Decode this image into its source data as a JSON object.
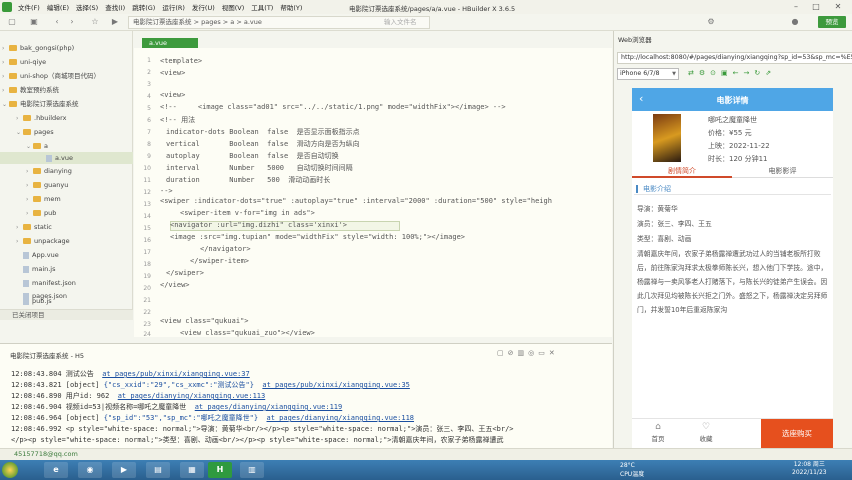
{
  "menu": {
    "items": [
      "文件(F)",
      "编辑(E)",
      "选择(S)",
      "查找(I)",
      "跳转(G)",
      "运行(R)",
      "发行(U)",
      "视图(V)",
      "工具(T)",
      "帮助(Y)"
    ],
    "title": "电影院订票选座系统/pages/a/a.vue - HBuilder X 3.6.5"
  },
  "toolbar": {
    "path": "电影院订票选座系统  >  pages  >  a  >  a.vue",
    "path_hint": "输入文件名",
    "preview": "预览"
  },
  "tree": {
    "items": [
      "bak_gongsi(php)",
      "uni-qiye",
      "uni-shop（商城项目代码）",
      "教室预约系统",
      "电影院订票选座系统",
      ".hbuilderx",
      "pages",
      "a",
      "a.vue",
      "dianying",
      "guanyu",
      "mem",
      "pub",
      "static",
      "unpackage",
      "App.vue",
      "main.js",
      "manifest.json",
      "pages.json",
      "pub.js"
    ],
    "footer": "已关闭项目"
  },
  "editor": {
    "tab": "a.vue",
    "line_numbers": [
      "1",
      "2",
      "3",
      "4",
      "5",
      "6",
      "7",
      "8",
      "9",
      "10",
      "11",
      "12",
      "13",
      "14",
      "15",
      "16",
      "17",
      "18",
      "19",
      "20",
      "21",
      "22",
      "23",
      "24"
    ]
  },
  "code": {
    "l1": "<template>",
    "l2": "<view>",
    "l3": "<view>",
    "l4": "<!--     <image class=\"ad01\" src=\"../../static/1.png\" mode=\"widthFix\"></image> -->",
    "l5": "<!-- 用法",
    "l6": "indicator-dots Boolean  false  是否显示面板指示点",
    "l7": "vertical       Boolean  false  滑动方向是否为纵向",
    "l8": "autoplay       Boolean  false  是否自动切换",
    "l9": "interval       Number   5000   自动切换时间间隔",
    "l10": "duration       Number   500  滑动动画时长",
    "l11": "-->",
    "l12": "<swiper :indicator-dots=\"true\" :autoplay=\"true\" :interval=\"2000\" :duration=\"500\" style=\"heigh",
    "l13": "<swiper-item v-for=\"img in ads\">",
    "l14": "<navigator :url=\"img.dizhi\" class='xinxi'>",
    "l15": "<image :src=\"img.tupian\" mode=\"widthFix\" style=\"width: 100%;\"></image>",
    "l16": "</navigator>",
    "l17": "</swiper-item>",
    "l18": "</swiper>",
    "l19": "</view>",
    "l20": "",
    "l21": "",
    "l22": "<view class=\"qukuai\">",
    "l23": "<view class=\"qukuai_zuo\"></view>"
  },
  "console": {
    "header": "电影院订票选座系统 - H5",
    "lines": [
      {
        "pre": "12:08:43.804 测试公告  ",
        "link": "at pages/pub/xinxi/xiangqing.vue:37",
        "obj": ""
      },
      {
        "pre": "12:08:43.821 [object] ",
        "obj": "{\"cs_xxid\":\"29\",\"cs_xxmc\":\"测试公告\"}",
        "link": "at pages/pub/xinxi/xiangqing.vue:35"
      },
      {
        "pre": "12:08:46.890 用户id: 962  ",
        "link": "at pages/dianying/xiangqing.vue:113",
        "obj": ""
      },
      {
        "pre": "12:08:46.904 视频id=53|视频名称=哪吒之魔童降世  ",
        "link": "at pages/dianying/xiangqing.vue:119",
        "obj": ""
      },
      {
        "pre": "12:08:46.964 [object] ",
        "obj": "{\"sp_id\":\"53\",\"sp_mc\":\"哪吒之魔童降世\"}",
        "link": "at pages/dianying/xiangqing.vue:118"
      },
      {
        "pre": "12:08:46.992 <p style=\"white-space: normal;\">导演：黄菊华<br/></p><p style=\"white-space: normal;\">演员：张三、李四、王五<br/>",
        "link": "",
        "obj": ""
      },
      {
        "pre": "</p><p style=\"white-space: normal;\">类型：喜剧、动画<br/></p><p style=\"white-space: normal;\">清朝嘉庆年间，农家子弟杨露禅遭武",
        "link": "",
        "obj": ""
      }
    ]
  },
  "status": {
    "text": "45157718@qq.com"
  },
  "browser": {
    "title": "Web浏览器",
    "url": "http://localhost:8080/#/pages/dianying/xiangqing?sp_id=53&sp_mc=%E5",
    "device": "iPhone 6/7/8",
    "page_title": "电影详情",
    "movie": {
      "name": "哪吒之魔童降世",
      "price": "价格：¥55 元",
      "date": "上映：2022-11-22",
      "duration": "时长：120 分钟11"
    },
    "tabs": [
      "剧情简介",
      "电影影评"
    ],
    "section": "电影介绍",
    "paras": [
      "导演：黄菊华",
      "演员：张三、李四、王五",
      "类型：喜剧、动画",
      "清朝嘉庆年间，农家子弟杨露禅遭武功过人的当铺老板所打败后，前往陈家沟拜求太极拳师陈长兴，想入他门下学技。途中，杨露禅与一卖风筝老人打赌落下，与陈长兴的徒弟产生误会。因此几次拜见均被陈长兴拒之门外。盛怒之下，杨露禅决定另拜师门，并发誓10年后重返陈家沟"
    ],
    "tabbar": {
      "home": "首页",
      "fav": "收藏",
      "buy": "选座购买"
    }
  },
  "taskbar": {
    "tray_temp": "28°C",
    "tray_cpu": "CPU温度",
    "time": "12:08 周三",
    "date": "2022/11/23"
  },
  "colors": {
    "accent_green": "#3d9a3d",
    "nav_blue": "#4fa6e6",
    "buy_red": "#e6501e"
  }
}
